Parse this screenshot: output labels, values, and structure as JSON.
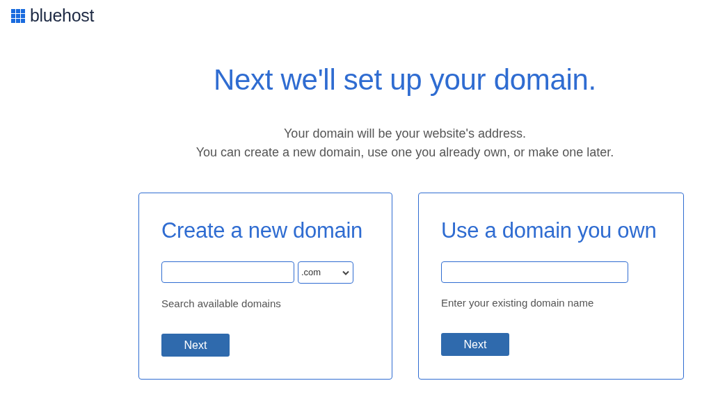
{
  "logo": {
    "text": "bluehost"
  },
  "heading": "Next we'll set up your domain.",
  "intro": [
    "Your domain will be your website's address.",
    "You can create a new domain, use one you already own, or make one later."
  ],
  "cards": [
    {
      "kind": "search",
      "title": "Create a new domain",
      "tld": ".com",
      "hint": "Search available domains",
      "button": "Next"
    },
    {
      "kind": "existing",
      "title": "Use a domain you own",
      "hint": "Enter your existing domain name",
      "button": "Next"
    }
  ]
}
